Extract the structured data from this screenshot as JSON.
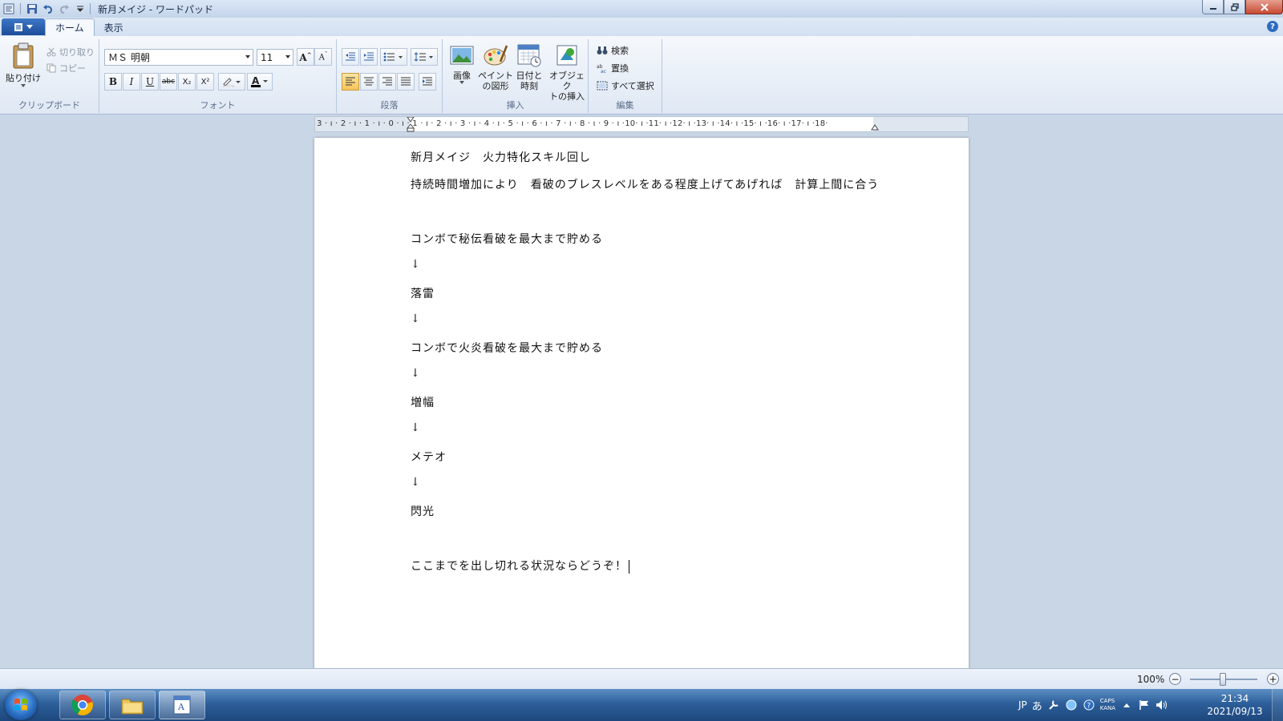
{
  "window": {
    "title": "新月メイジ - ワードパッド"
  },
  "tabs": [
    {
      "label": "ホーム",
      "active": true
    },
    {
      "label": "表示",
      "active": false
    }
  ],
  "ribbon": {
    "clipboard": {
      "paste_label": "貼り付け",
      "cut_label": "切り取り",
      "copy_label": "コピー",
      "group_label": "クリップボード"
    },
    "font": {
      "family": "ＭＳ 明朝",
      "size": "11",
      "group_label": "フォント",
      "bold": "B",
      "italic": "I",
      "underline": "U",
      "strike": "abc",
      "sub": "X₂",
      "sup": "X²"
    },
    "paragraph": {
      "group_label": "段落"
    },
    "insert": {
      "group_label": "挿入",
      "image_label": "画像",
      "paint_label_1": "ペイント",
      "paint_label_2": "の図形",
      "datetime_label_1": "日付と",
      "datetime_label_2": "時刻",
      "object_label_1": "オブジェク",
      "object_label_2": "トの挿入"
    },
    "edit": {
      "group_label": "編集",
      "find_label": "検索",
      "replace_label": "置換",
      "select_all_label": "すべて選択"
    }
  },
  "ruler": {
    "text": "3 · ı · 2 · ı · 1 · ı · 0 · ı · 1 · ı · 2 · ı · 3 · ı · 4 · ı · 5 · ı · 6 · ı · 7 · ı · 8 · ı · 9 · ı ·10· ı ·11· ı ·12· ı ·13· ı ·14· ı ·15· ı ·16· ı ·17· ı ·18·"
  },
  "document": {
    "lines": [
      "新月メイジ　火力特化スキル回し",
      "持続時間増加により　看破のブレスレベルをある程度上げてあげれば　計算上間に合う",
      "",
      "コンボで秘伝看破を最大まで貯める",
      "↓",
      "落雷",
      "↓",
      "コンボで火炎看破を最大まで貯める",
      "↓",
      "増幅",
      "↓",
      "メテオ",
      "↓",
      "閃光",
      "",
      "ここまでを出し切れる状況ならどうぞ！"
    ]
  },
  "status": {
    "zoom": "100%"
  },
  "taskbar": {
    "tray_lang": "JP",
    "tray_ime": "あ",
    "caps": "CAPS",
    "kana": "KANA",
    "time": "21:34",
    "date": "2021/09/13"
  }
}
